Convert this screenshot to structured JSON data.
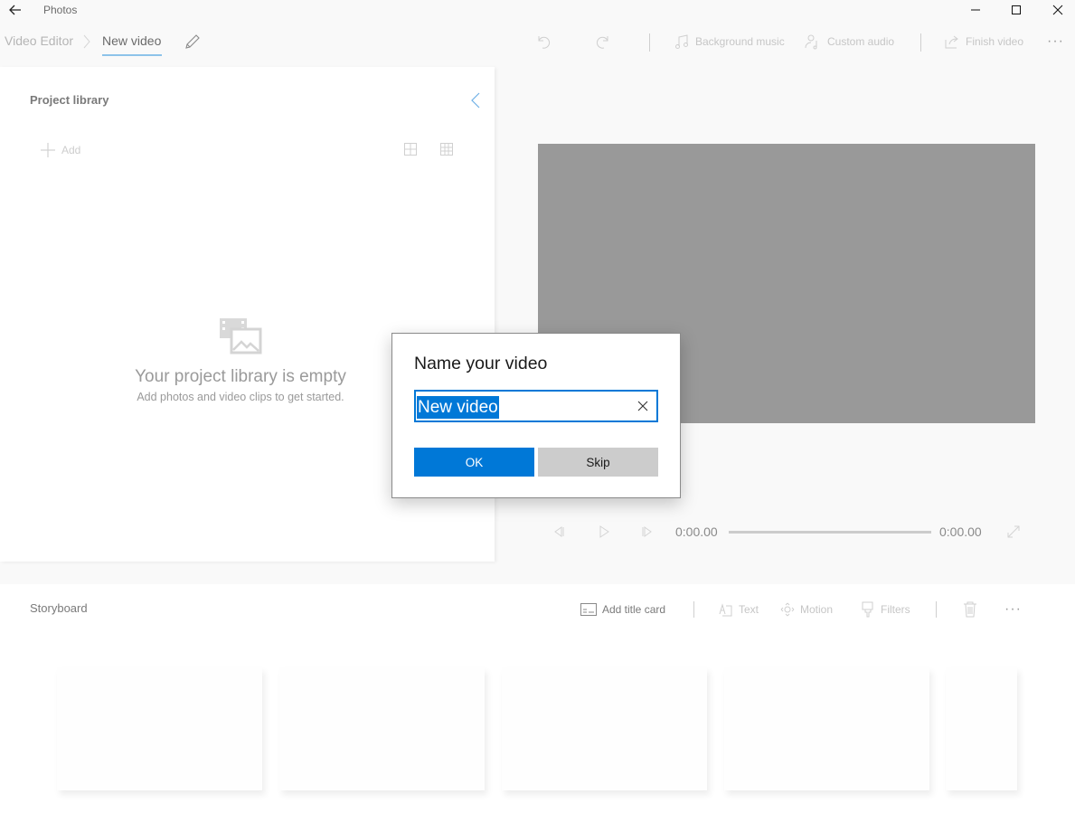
{
  "app": {
    "title": "Photos"
  },
  "window_controls": {
    "minimize": "minimize",
    "maximize": "maximize",
    "close": "close"
  },
  "breadcrumb": {
    "root": "Video Editor",
    "current": "New video"
  },
  "toolbar": {
    "background_music": "Background music",
    "custom_audio": "Custom audio",
    "finish_video": "Finish video",
    "more": "···"
  },
  "library": {
    "title": "Project library",
    "add_label": "Add",
    "empty_title": "Your project library is empty",
    "empty_subtitle": "Add photos and video clips to get started."
  },
  "player": {
    "current_time": "0:00.00",
    "total_time": "0:00.00",
    "progress": 0
  },
  "storyboard": {
    "title": "Storyboard",
    "add_title_card": "Add title card",
    "text": "Text",
    "motion": "Motion",
    "filters": "Filters",
    "more": "···",
    "slots": 5
  },
  "dialog": {
    "title": "Name your video",
    "input_value": "New video",
    "ok_label": "OK",
    "skip_label": "Skip"
  },
  "colors": {
    "accent": "#0078d7",
    "preview_bg": "#999999",
    "underline": "#8dc3ea"
  }
}
